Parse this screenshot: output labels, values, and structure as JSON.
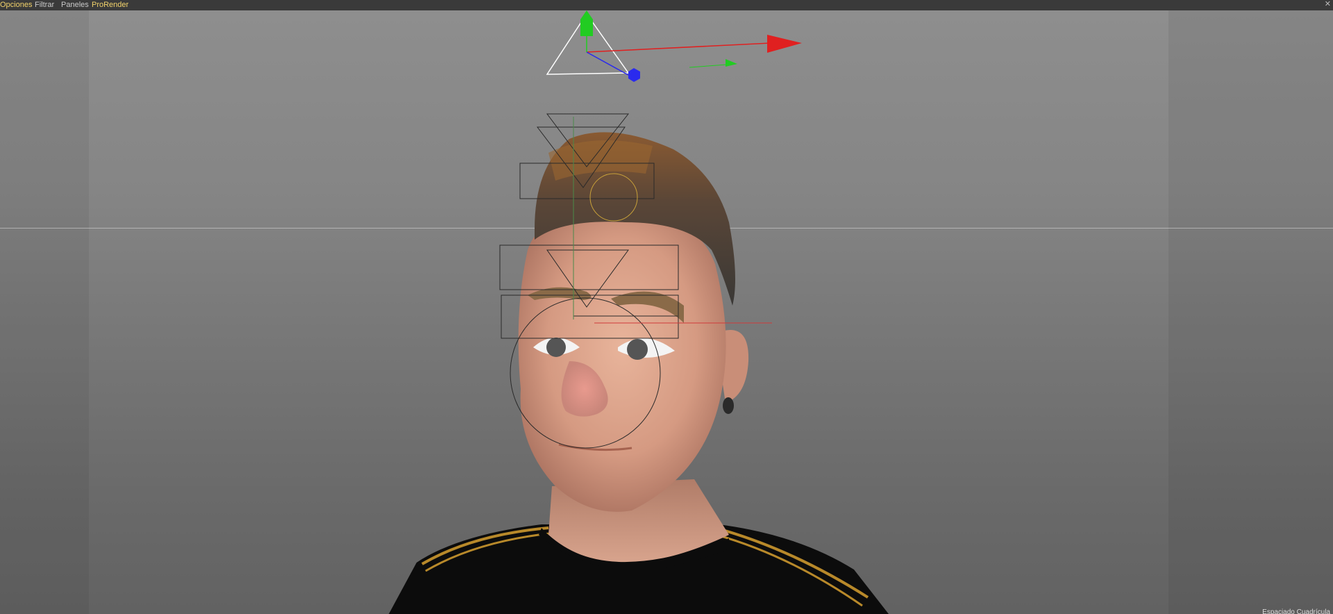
{
  "menubar": {
    "items": [
      {
        "label": "Opciones",
        "highlight": true
      },
      {
        "label": "Filtrar",
        "highlight": false
      },
      {
        "label": "Paneles",
        "highlight": false
      },
      {
        "label": "ProRender",
        "highlight": true
      }
    ],
    "close_glyph": "✕"
  },
  "viewport": {
    "status_text": "Espaciado Cuadrícula"
  },
  "colors": {
    "axis_x": "#e02020",
    "axis_y": "#22cc22",
    "axis_z": "#2a2aee",
    "menu_highlight": "#f3d36b"
  }
}
